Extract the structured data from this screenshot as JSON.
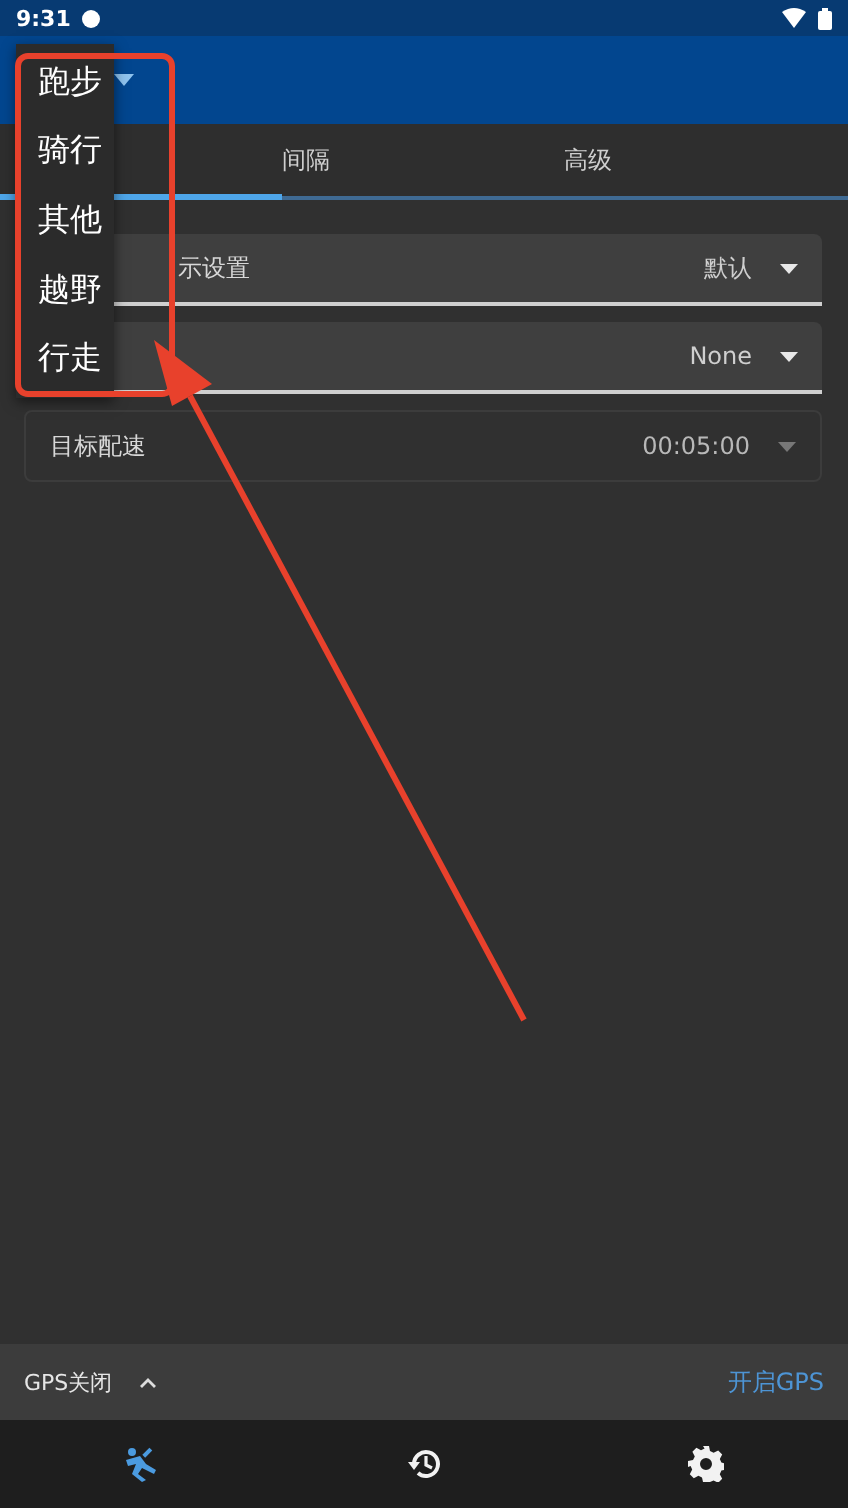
{
  "status_bar": {
    "time": "9:31"
  },
  "tabs": [
    {
      "selected": true
    },
    {
      "label": "间隔",
      "selected": false
    },
    {
      "label": "高级",
      "selected": false
    }
  ],
  "settings": [
    {
      "kind": "filled",
      "label": "示设置",
      "value": "默认",
      "disabled": false
    },
    {
      "kind": "filled",
      "value": "None",
      "disabled": false
    },
    {
      "kind": "outlined",
      "label": "目标配速",
      "value": "00:05:00",
      "disabled": true
    }
  ],
  "activity_menu": {
    "items": [
      "跑步",
      "骑行",
      "其他",
      "越野",
      "行走"
    ]
  },
  "gps_bar": {
    "status": "GPS关闭",
    "action": "开启GPS"
  },
  "nav": [
    {
      "kind": "run",
      "selected": true
    },
    {
      "kind": "history",
      "selected": false
    },
    {
      "kind": "settings",
      "selected": false
    }
  ],
  "annotations": {
    "highlight_frame": true,
    "arrow": true
  }
}
